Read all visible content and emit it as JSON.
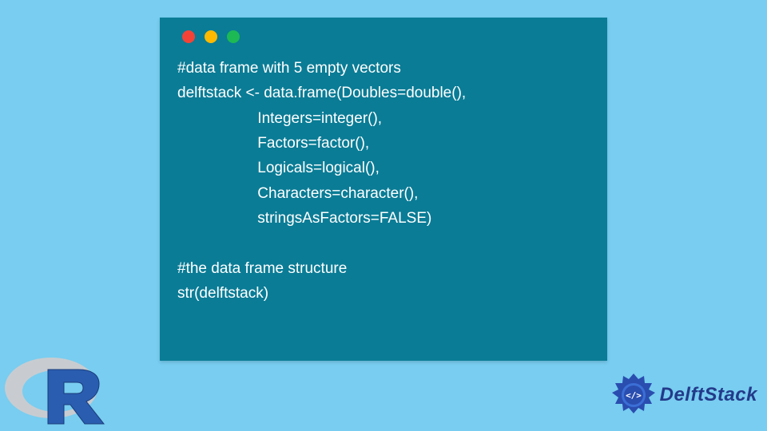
{
  "code": {
    "line1": "#data frame with 5 empty vectors",
    "line2": "delftstack <- data.frame(Doubles=double(),",
    "line3": "                   Integers=integer(),",
    "line4": "                   Factors=factor(),",
    "line5": "                   Logicals=logical(),",
    "line6": "                   Characters=character(),",
    "line7": "                   stringsAsFactors=FALSE)",
    "line8": "",
    "line9": "#the data frame structure",
    "line10": "str(delftstack)"
  },
  "branding": {
    "delftstack_label": "DelftStack"
  }
}
